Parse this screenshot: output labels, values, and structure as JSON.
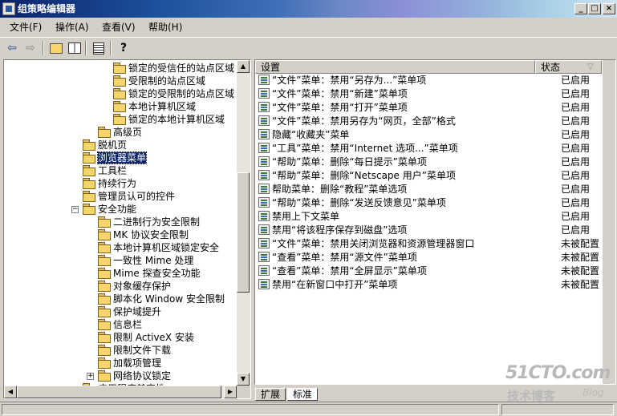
{
  "window": {
    "title": "组策略编辑器",
    "controls": {
      "minimize": "_",
      "maximize": "□",
      "close": "×"
    }
  },
  "menubar": [
    {
      "label": "文件(F)"
    },
    {
      "label": "操作(A)"
    },
    {
      "label": "查看(V)"
    },
    {
      "label": "帮助(H)"
    }
  ],
  "toolbar": {
    "icons": [
      "back-arrow-icon",
      "forward-arrow-icon",
      "up-folder-icon",
      "show-hide-tree-icon",
      "export-list-icon",
      "help-icon"
    ]
  },
  "tree": {
    "items": [
      {
        "label": "锁定的受信任的站点区域",
        "indent": 4
      },
      {
        "label": "受限制的站点区域",
        "indent": 4
      },
      {
        "label": "锁定的受限制的站点区域",
        "indent": 4
      },
      {
        "label": "本地计算机区域",
        "indent": 4
      },
      {
        "label": "锁定的本地计算机区域",
        "indent": 4
      },
      {
        "label": "高级页",
        "indent": 3
      },
      {
        "label": "脱机页",
        "indent": 2
      },
      {
        "label": "浏览器菜单",
        "indent": 2,
        "selected": true
      },
      {
        "label": "工具栏",
        "indent": 2
      },
      {
        "label": "持续行为",
        "indent": 2
      },
      {
        "label": "管理员认可的控件",
        "indent": 2
      },
      {
        "label": "安全功能",
        "indent": 2,
        "expander": "minus"
      },
      {
        "label": "二进制行为安全限制",
        "indent": 3
      },
      {
        "label": "MK 协议安全限制",
        "indent": 3
      },
      {
        "label": "本地计算机区域锁定安全",
        "indent": 3
      },
      {
        "label": "一致性 Mime 处理",
        "indent": 3
      },
      {
        "label": "Mime 探查安全功能",
        "indent": 3
      },
      {
        "label": "对象缓存保护",
        "indent": 3
      },
      {
        "label": "脚本化 Window 安全限制",
        "indent": 3
      },
      {
        "label": "保护域提升",
        "indent": 3
      },
      {
        "label": "信息栏",
        "indent": 3
      },
      {
        "label": "限制 ActiveX 安装",
        "indent": 3
      },
      {
        "label": "限制文件下载",
        "indent": 3
      },
      {
        "label": "加载项管理",
        "indent": 3
      },
      {
        "label": "网络协议锁定",
        "indent": 3,
        "expander": "plus"
      },
      {
        "label": "应用程序兼容性",
        "indent": 2,
        "expander": "plus"
      }
    ]
  },
  "list": {
    "columns": {
      "setting": "设置",
      "state": "状态"
    },
    "rows": [
      {
        "setting": "“文件”菜单：禁用“另存为...”菜单项",
        "state": "已启用"
      },
      {
        "setting": "“文件”菜单：禁用“新建”菜单项",
        "state": "已启用"
      },
      {
        "setting": "“文件”菜单：禁用“打开”菜单项",
        "state": "已启用"
      },
      {
        "setting": "“文件”菜单：禁用另存为“网页，全部”格式",
        "state": "已启用"
      },
      {
        "setting": "隐藏“收藏夹”菜单",
        "state": "已启用"
      },
      {
        "setting": "“工具”菜单：禁用“Internet 选项...”菜单项",
        "state": "已启用"
      },
      {
        "setting": "“帮助”菜单：删除“每日提示”菜单项",
        "state": "已启用"
      },
      {
        "setting": "“帮助”菜单：删除“Netscape 用户”菜单项",
        "state": "已启用"
      },
      {
        "setting": "帮助菜单：删除“教程”菜单选项",
        "state": "已启用"
      },
      {
        "setting": "“帮助”菜单：删除“发送反馈意见”菜单项",
        "state": "已启用"
      },
      {
        "setting": "禁用上下文菜单",
        "state": "已启用"
      },
      {
        "setting": "禁用“将该程序保存到磁盘”选项",
        "state": "已启用"
      },
      {
        "setting": "“文件”菜单：禁用关闭浏览器和资源管理器窗口",
        "state": "未被配置"
      },
      {
        "setting": "“查看”菜单：禁用“源文件”菜单项",
        "state": "未被配置"
      },
      {
        "setting": "“查看”菜单：禁用“全屏显示”菜单项",
        "state": "未被配置"
      },
      {
        "setting": "禁用“在新窗口中打开”菜单项",
        "state": "未被配置"
      }
    ]
  },
  "tabs": [
    {
      "label": "扩展",
      "active": false
    },
    {
      "label": "标准",
      "active": true
    }
  ],
  "watermark": {
    "line1": "51CTO.com",
    "line2": "技术博客",
    "line3": "Blog"
  }
}
